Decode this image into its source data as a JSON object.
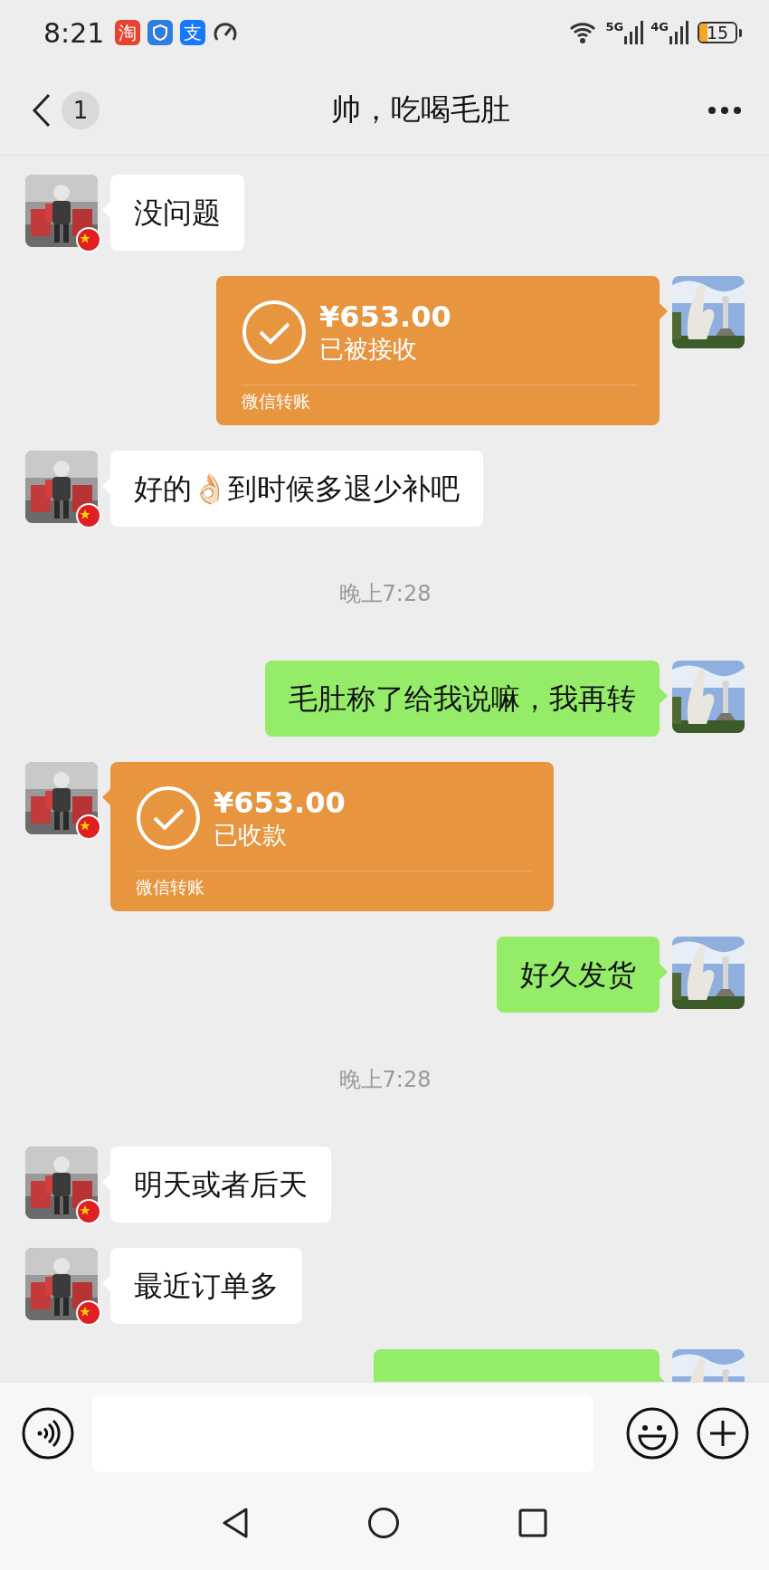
{
  "status_bar": {
    "time": "8:21",
    "app_icons": [
      {
        "kind": "glyph",
        "text": "淘",
        "color": "#e8432f"
      },
      {
        "kind": "shield",
        "color": "#2f7de1"
      },
      {
        "kind": "glyph",
        "text": "支",
        "color": "#1677ff"
      },
      {
        "kind": "gauge"
      }
    ],
    "network": [
      "5G",
      "4G"
    ],
    "battery": "15"
  },
  "header": {
    "unread": "1",
    "title": "帅，吃喝毛肚"
  },
  "messages": [
    {
      "kind": "text",
      "outgoing": false,
      "text": "没问题"
    },
    {
      "kind": "transfer",
      "outgoing": true,
      "amount": "¥653.00",
      "status": "已被接收",
      "footer": "微信转账"
    },
    {
      "kind": "text",
      "outgoing": false,
      "text": "好的👌🏻到时候多退少补吧"
    },
    {
      "kind": "time",
      "text": "晚上7:28"
    },
    {
      "kind": "text",
      "outgoing": true,
      "text": "毛肚称了给我说嘛，我再转"
    },
    {
      "kind": "transfer",
      "outgoing": false,
      "amount": "¥653.00",
      "status": "已收款",
      "footer": "微信转账"
    },
    {
      "kind": "text",
      "outgoing": true,
      "text": "好久发货"
    },
    {
      "kind": "time",
      "text": "晚上7:28"
    },
    {
      "kind": "text",
      "outgoing": false,
      "text": "明天或者后天"
    },
    {
      "kind": "text",
      "outgoing": false,
      "text": "最近订单多"
    },
    {
      "kind": "text",
      "outgoing": true
    }
  ]
}
